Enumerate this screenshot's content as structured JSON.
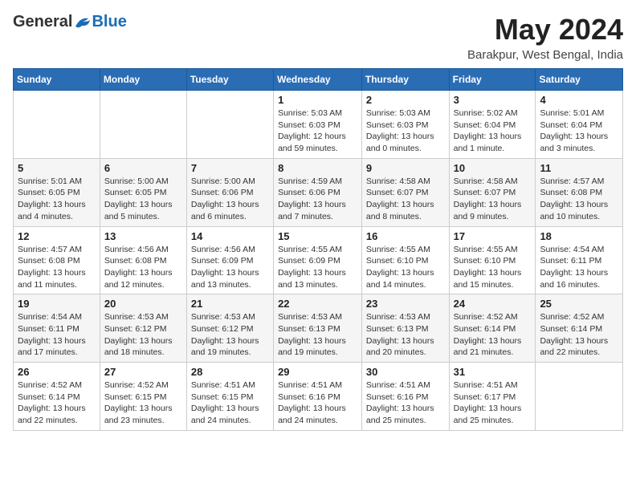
{
  "logo": {
    "general": "General",
    "blue": "Blue"
  },
  "title": {
    "month_year": "May 2024",
    "location": "Barakpur, West Bengal, India"
  },
  "headers": [
    "Sunday",
    "Monday",
    "Tuesday",
    "Wednesday",
    "Thursday",
    "Friday",
    "Saturday"
  ],
  "weeks": [
    [
      {
        "day": "",
        "info": ""
      },
      {
        "day": "",
        "info": ""
      },
      {
        "day": "",
        "info": ""
      },
      {
        "day": "1",
        "info": "Sunrise: 5:03 AM\nSunset: 6:03 PM\nDaylight: 12 hours and 59 minutes."
      },
      {
        "day": "2",
        "info": "Sunrise: 5:03 AM\nSunset: 6:03 PM\nDaylight: 13 hours and 0 minutes."
      },
      {
        "day": "3",
        "info": "Sunrise: 5:02 AM\nSunset: 6:04 PM\nDaylight: 13 hours and 1 minute."
      },
      {
        "day": "4",
        "info": "Sunrise: 5:01 AM\nSunset: 6:04 PM\nDaylight: 13 hours and 3 minutes."
      }
    ],
    [
      {
        "day": "5",
        "info": "Sunrise: 5:01 AM\nSunset: 6:05 PM\nDaylight: 13 hours and 4 minutes."
      },
      {
        "day": "6",
        "info": "Sunrise: 5:00 AM\nSunset: 6:05 PM\nDaylight: 13 hours and 5 minutes."
      },
      {
        "day": "7",
        "info": "Sunrise: 5:00 AM\nSunset: 6:06 PM\nDaylight: 13 hours and 6 minutes."
      },
      {
        "day": "8",
        "info": "Sunrise: 4:59 AM\nSunset: 6:06 PM\nDaylight: 13 hours and 7 minutes."
      },
      {
        "day": "9",
        "info": "Sunrise: 4:58 AM\nSunset: 6:07 PM\nDaylight: 13 hours and 8 minutes."
      },
      {
        "day": "10",
        "info": "Sunrise: 4:58 AM\nSunset: 6:07 PM\nDaylight: 13 hours and 9 minutes."
      },
      {
        "day": "11",
        "info": "Sunrise: 4:57 AM\nSunset: 6:08 PM\nDaylight: 13 hours and 10 minutes."
      }
    ],
    [
      {
        "day": "12",
        "info": "Sunrise: 4:57 AM\nSunset: 6:08 PM\nDaylight: 13 hours and 11 minutes."
      },
      {
        "day": "13",
        "info": "Sunrise: 4:56 AM\nSunset: 6:08 PM\nDaylight: 13 hours and 12 minutes."
      },
      {
        "day": "14",
        "info": "Sunrise: 4:56 AM\nSunset: 6:09 PM\nDaylight: 13 hours and 13 minutes."
      },
      {
        "day": "15",
        "info": "Sunrise: 4:55 AM\nSunset: 6:09 PM\nDaylight: 13 hours and 13 minutes."
      },
      {
        "day": "16",
        "info": "Sunrise: 4:55 AM\nSunset: 6:10 PM\nDaylight: 13 hours and 14 minutes."
      },
      {
        "day": "17",
        "info": "Sunrise: 4:55 AM\nSunset: 6:10 PM\nDaylight: 13 hours and 15 minutes."
      },
      {
        "day": "18",
        "info": "Sunrise: 4:54 AM\nSunset: 6:11 PM\nDaylight: 13 hours and 16 minutes."
      }
    ],
    [
      {
        "day": "19",
        "info": "Sunrise: 4:54 AM\nSunset: 6:11 PM\nDaylight: 13 hours and 17 minutes."
      },
      {
        "day": "20",
        "info": "Sunrise: 4:53 AM\nSunset: 6:12 PM\nDaylight: 13 hours and 18 minutes."
      },
      {
        "day": "21",
        "info": "Sunrise: 4:53 AM\nSunset: 6:12 PM\nDaylight: 13 hours and 19 minutes."
      },
      {
        "day": "22",
        "info": "Sunrise: 4:53 AM\nSunset: 6:13 PM\nDaylight: 13 hours and 19 minutes."
      },
      {
        "day": "23",
        "info": "Sunrise: 4:53 AM\nSunset: 6:13 PM\nDaylight: 13 hours and 20 minutes."
      },
      {
        "day": "24",
        "info": "Sunrise: 4:52 AM\nSunset: 6:14 PM\nDaylight: 13 hours and 21 minutes."
      },
      {
        "day": "25",
        "info": "Sunrise: 4:52 AM\nSunset: 6:14 PM\nDaylight: 13 hours and 22 minutes."
      }
    ],
    [
      {
        "day": "26",
        "info": "Sunrise: 4:52 AM\nSunset: 6:14 PM\nDaylight: 13 hours and 22 minutes."
      },
      {
        "day": "27",
        "info": "Sunrise: 4:52 AM\nSunset: 6:15 PM\nDaylight: 13 hours and 23 minutes."
      },
      {
        "day": "28",
        "info": "Sunrise: 4:51 AM\nSunset: 6:15 PM\nDaylight: 13 hours and 24 minutes."
      },
      {
        "day": "29",
        "info": "Sunrise: 4:51 AM\nSunset: 6:16 PM\nDaylight: 13 hours and 24 minutes."
      },
      {
        "day": "30",
        "info": "Sunrise: 4:51 AM\nSunset: 6:16 PM\nDaylight: 13 hours and 25 minutes."
      },
      {
        "day": "31",
        "info": "Sunrise: 4:51 AM\nSunset: 6:17 PM\nDaylight: 13 hours and 25 minutes."
      },
      {
        "day": "",
        "info": ""
      }
    ]
  ]
}
